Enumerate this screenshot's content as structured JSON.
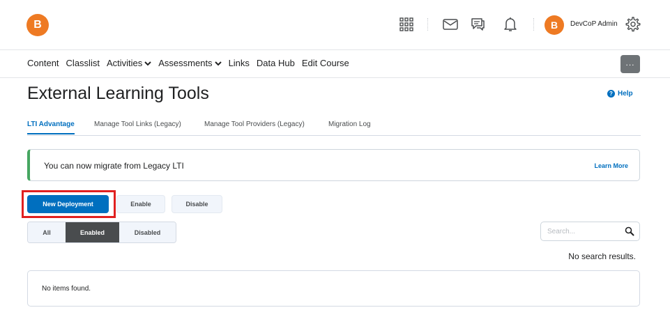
{
  "header": {
    "logo_letter": "B",
    "avatar_letter": "B",
    "user_name": "DevCoP Admin",
    "brand_color": "#ee7a23",
    "icons": [
      "apps-grid-icon",
      "mail-icon",
      "chat-icon",
      "bell-icon",
      "gear-icon"
    ]
  },
  "nav": {
    "items": [
      {
        "label": "Content"
      },
      {
        "label": "Classlist"
      },
      {
        "label": "Activities",
        "dropdown": true
      },
      {
        "label": "Assessments",
        "dropdown": true
      },
      {
        "label": "Links"
      },
      {
        "label": "Data Hub"
      },
      {
        "label": "Edit Course"
      }
    ],
    "more_label": "..."
  },
  "page": {
    "title": "External Learning Tools",
    "help_label": "Help"
  },
  "tabs": [
    {
      "label": "LTI Advantage",
      "active": true
    },
    {
      "label": "Manage Tool Links (Legacy)"
    },
    {
      "label": "Manage Tool Providers (Legacy)"
    },
    {
      "label": "Migration Log"
    }
  ],
  "alert": {
    "text": "You can now migrate from Legacy LTI",
    "link": "Learn More",
    "accent_color": "#46a661"
  },
  "actions": {
    "new_deployment": "New Deployment",
    "enable": "Enable",
    "disable": "Disable"
  },
  "filter": {
    "options": [
      "All",
      "Enabled",
      "Disabled"
    ],
    "selected": "Enabled"
  },
  "search": {
    "placeholder": "Search...",
    "value": ""
  },
  "results": {
    "no_search_results": "No search results.",
    "empty_text": "No items found."
  },
  "colors": {
    "primary": "#006fbf",
    "highlight": "#e02020"
  }
}
